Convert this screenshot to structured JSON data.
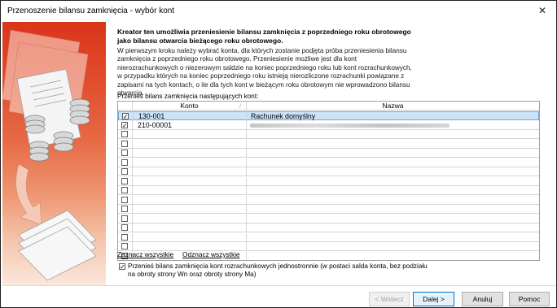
{
  "window": {
    "title": "Przenoszenie bilansu zamknięcia - wybór kont",
    "close_glyph": "✕"
  },
  "intro": {
    "bold_text": "Kreator ten umożliwia przeniesienie bilansu zamknięcia z poprzedniego roku obrotowego jako bilansu otwarcia bieżącego roku obrotowego.",
    "description": "W pierwszym kroku należy wybrać konta, dla których zostanie podjęta próba przeniesienia bilansu zamknięcia z poprzedniego roku obrotowego. Przeniesienie możliwe jest dla kont nierozrachunkowych o niezerowym saldzie na koniec poprzedniego roku lub kont rozrachunkowych, w przypadku których na koniec poprzedniego roku istnieją nierozliczone rozrachunki powiązane z zapisami na tych kontach, o ile dla tych kont w bieżącym roku obrotowym nie wprowadzono bilansu otwarcia."
  },
  "grid": {
    "label": "Przenieś bilans zamknięcia następujących kont:",
    "columns": {
      "konto": "Konto",
      "nazwa": "Nazwa"
    },
    "sort_glyph": "/",
    "check_glyph": "✓",
    "rows": [
      {
        "checked": true,
        "konto": "130-001",
        "nazwa": "Rachunek domyślny",
        "selected": true,
        "nazwa_blurred": false
      },
      {
        "checked": true,
        "konto": "210-00001",
        "nazwa": "",
        "selected": false,
        "nazwa_blurred": true
      },
      {
        "checked": false,
        "konto": "",
        "nazwa": ""
      },
      {
        "checked": false,
        "konto": "",
        "nazwa": ""
      },
      {
        "checked": false,
        "konto": "",
        "nazwa": ""
      },
      {
        "checked": false,
        "konto": "",
        "nazwa": ""
      },
      {
        "checked": false,
        "konto": "",
        "nazwa": ""
      },
      {
        "checked": false,
        "konto": "",
        "nazwa": ""
      },
      {
        "checked": false,
        "konto": "",
        "nazwa": ""
      },
      {
        "checked": false,
        "konto": "",
        "nazwa": ""
      },
      {
        "checked": false,
        "konto": "",
        "nazwa": ""
      },
      {
        "checked": false,
        "konto": "",
        "nazwa": ""
      },
      {
        "checked": false,
        "konto": "",
        "nazwa": ""
      },
      {
        "checked": false,
        "konto": "",
        "nazwa": ""
      },
      {
        "checked": false,
        "konto": "",
        "nazwa": ""
      },
      {
        "checked": false,
        "konto": "",
        "nazwa": ""
      }
    ]
  },
  "links": {
    "select_all": "Zaznacz wszystkie",
    "deselect_all": "Odznacz wszystkie"
  },
  "option": {
    "checked": true,
    "label": "Przenieś bilans zamknięcia kont rozrachunkowych jednostronnie (w postaci salda konta, bez podziału na obroty strony Wn oraz obroty strony Ma)"
  },
  "buttons": {
    "back": "< Wstecz",
    "next": "Dalej >",
    "cancel": "Anuluj",
    "help": "Pomoc"
  },
  "colors": {
    "accent": "#0078d7",
    "selection": "#cde4f7",
    "side_top": "#d9351a",
    "side_bottom": "#fbe7dc"
  },
  "icons": {
    "close": "close-icon",
    "side_art": "documents-coins-illustration"
  }
}
